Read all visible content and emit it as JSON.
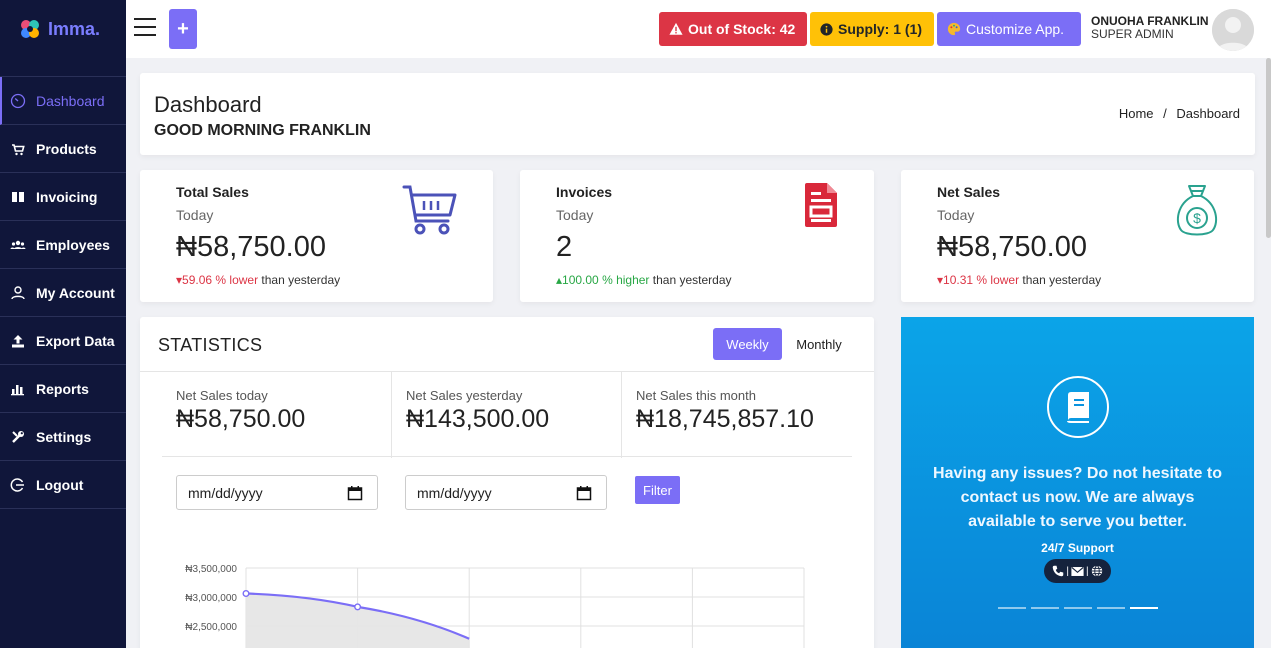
{
  "brand": {
    "name": "Imma.",
    "logo": "petal-logo-icon"
  },
  "sidebar": {
    "items": [
      {
        "label": "Dashboard",
        "icon": "dashboard-gauge-icon",
        "active": true
      },
      {
        "label": "Products",
        "icon": "cart-icon"
      },
      {
        "label": "Invoicing",
        "icon": "book-icon"
      },
      {
        "label": "Employees",
        "icon": "users-icon"
      },
      {
        "label": "My Account",
        "icon": "user-icon"
      },
      {
        "label": "Export Data",
        "icon": "upload-icon"
      },
      {
        "label": "Reports",
        "icon": "bar-chart-icon"
      },
      {
        "label": "Settings",
        "icon": "tools-icon"
      },
      {
        "label": "Logout",
        "icon": "logout-icon"
      }
    ]
  },
  "topbar": {
    "add_label": "+",
    "out_of_stock": "Out of Stock: 42",
    "supply": "Supply: 1 (1)",
    "customize": "Customize App.",
    "user_name": "ONUOHA FRANKLIN",
    "user_role": "SUPER ADMIN"
  },
  "header": {
    "title": "Dashboard",
    "greeting": "GOOD MORNING FRANKLIN",
    "breadcrumb_home": "Home",
    "breadcrumb_sep": "/",
    "breadcrumb_current": "Dashboard"
  },
  "cards": [
    {
      "title": "Total Sales",
      "sub": "Today",
      "value": "₦58,750.00",
      "arrow": "▾",
      "change": "59.06 % lower",
      "suffix": " than yesterday",
      "trend": "down",
      "icon": "shopping-cart-icon",
      "icon_color": "#4b52b8"
    },
    {
      "title": "Invoices",
      "sub": "Today",
      "value": "2",
      "arrow": "▴",
      "change": "100.00 % higher",
      "suffix": " than yesterday",
      "trend": "up",
      "icon": "document-icon",
      "icon_color": "#d9283a"
    },
    {
      "title": "Net Sales",
      "sub": "Today",
      "value": "₦58,750.00",
      "arrow": "▾",
      "change": "10.31 % lower",
      "suffix": " than yesterday",
      "trend": "down",
      "icon": "money-bag-icon",
      "icon_color": "#2aa28f"
    }
  ],
  "statistics": {
    "title": "STATISTICS",
    "weekly": "Weekly",
    "monthly": "Monthly",
    "kpis": [
      {
        "label": "Net Sales today",
        "value": "₦58,750.00"
      },
      {
        "label": "Net Sales yesterday",
        "value": "₦143,500.00"
      },
      {
        "label": "Net Sales this month",
        "value": "₦18,745,857.10"
      }
    ],
    "date_placeholder_1": "mm/dd/yyyy",
    "date_placeholder_2": "mm/dd/yyyy",
    "filter": "Filter"
  },
  "chart_data": {
    "type": "area",
    "y_ticks": [
      "₦3,500,000",
      "₦3,000,000",
      "₦2,500,000"
    ],
    "ylim_visible": [
      2500000,
      3500000
    ],
    "series": [
      {
        "values": [
          3060000,
          2830000,
          2280000
        ]
      }
    ],
    "line_color": "#7b6ef6",
    "fill_color": "#e6e6e6",
    "grid": true
  },
  "support": {
    "text": "Having any issues? Do not hesitate to contact us now. We are always available to serve you better.",
    "sub": "24/7 Support",
    "icons": [
      "phone-icon",
      "mail-icon",
      "globe-icon"
    ]
  },
  "colors": {
    "accent": "#7b6ef6",
    "sidebar": "#10163a",
    "danger": "#dc3545",
    "warning": "#ffc107",
    "success": "#28a745",
    "support_bg": "#0a93df"
  }
}
